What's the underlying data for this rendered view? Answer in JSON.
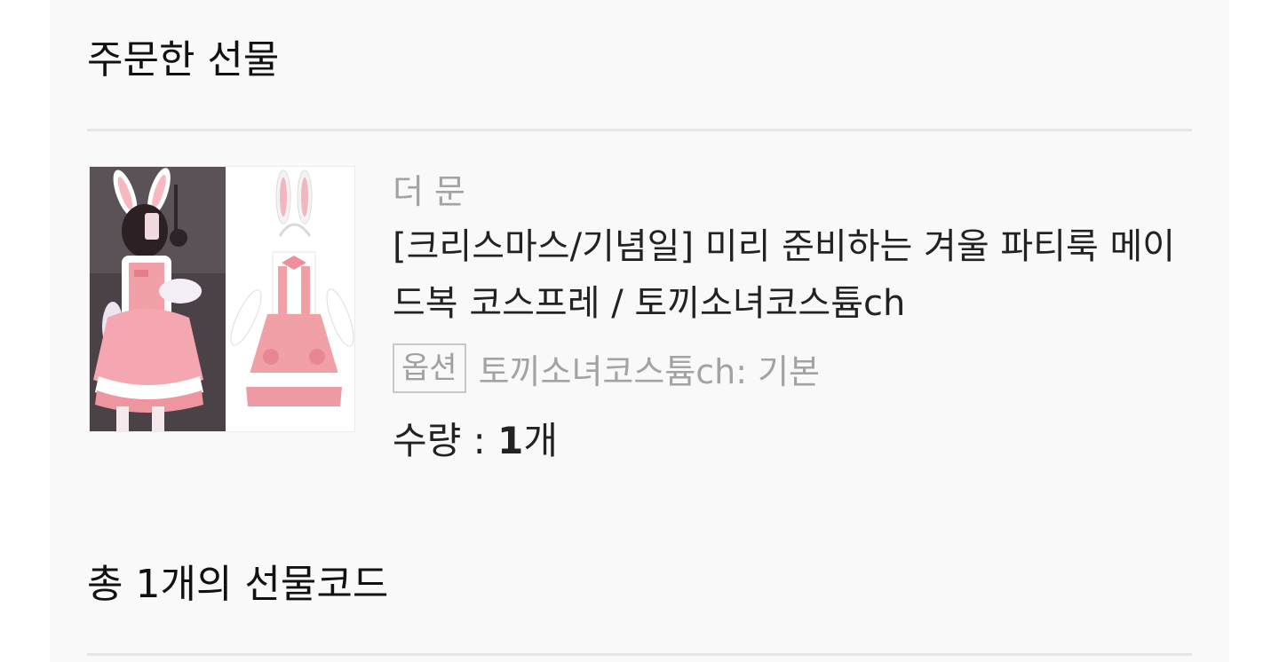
{
  "ordered_section": {
    "title": "주문한 선물"
  },
  "product": {
    "brand": "더 문",
    "name": "[크리스마스/기념일] 미리 준비하는 겨울 파티룩 메이드복 코스프레 / 토끼소녀코스튬ch",
    "option_badge": "옵션",
    "option_value": "토끼소녀코스튬ch: 기본",
    "quantity_label": "수량 : ",
    "quantity_value": "1",
    "quantity_unit": "개",
    "image_alt": "bunny maid costume product photo",
    "colors": {
      "pink": "#f2a0a8",
      "light_pink": "#f9c9cf",
      "white": "#ffffff",
      "dark_bg": "#3b3338"
    }
  },
  "codes_section": {
    "title": "총 1개의 선물코드"
  }
}
